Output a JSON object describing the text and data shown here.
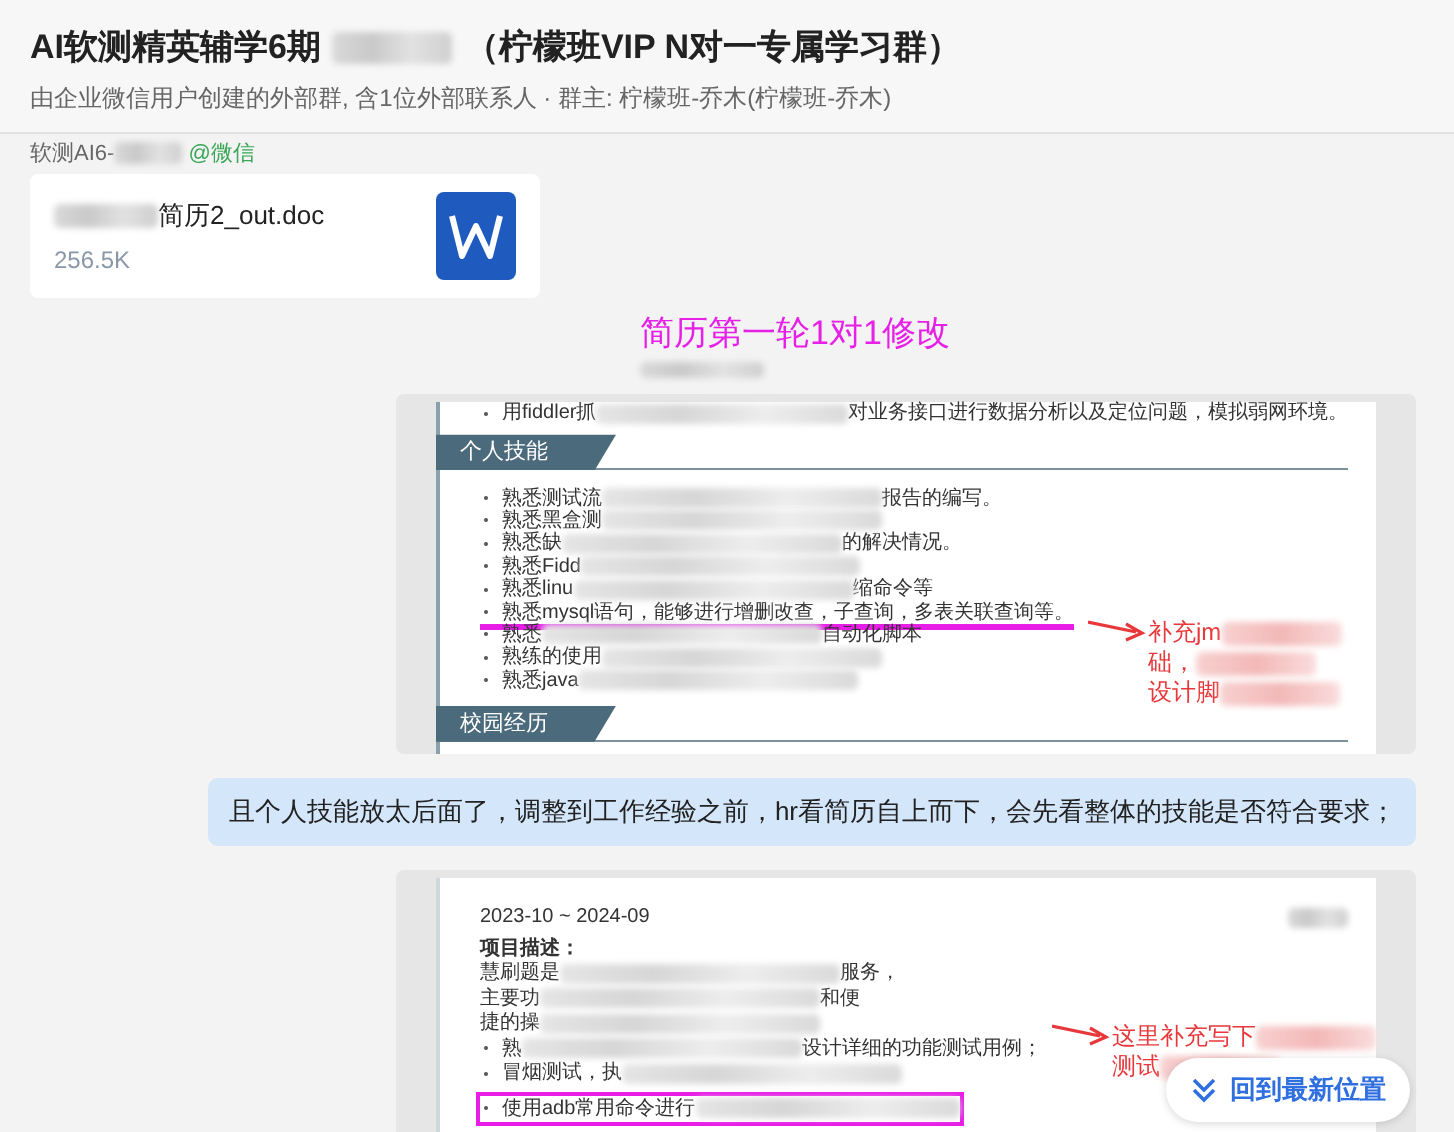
{
  "header": {
    "title_start": "AI软测精英辅学6期",
    "title_end": "（柠檬班VIP N对一专属学习群）",
    "subtitle": "由企业微信用户创建的外部群, 含1位外部联系人 · 群主: 柠檬班-乔木(柠檬班-乔木)"
  },
  "messages": [
    {
      "kind": "sender",
      "name": "软测AI6-",
      "tag": "@微信"
    },
    {
      "kind": "file",
      "name": "简历2_out.doc",
      "size": "256.5K"
    },
    {
      "kind": "note",
      "text": "简历第一轮1对1修改"
    },
    {
      "kind": "image",
      "rows": [
        {
          "kind": "line",
          "start": "用fiddler抓",
          "end": "对业务接口进行数据分析以及定位问题，模拟弱网环境。",
          "bullet": true,
          "redacted": true,
          "highlighted": false
        },
        {
          "kind": "heading",
          "text": "个人技能"
        },
        {
          "kind": "line",
          "start": "熟悉测试流",
          "end": "报告的编写。",
          "bullet": true,
          "redacted": true,
          "highlighted": false
        },
        {
          "kind": "line",
          "start": "熟悉黑盒测",
          "bullet": true,
          "redacted": true,
          "highlighted": false
        },
        {
          "kind": "line",
          "start": "熟悉缺",
          "end": "的解决情况。",
          "bullet": true,
          "redacted": true,
          "highlighted": false
        },
        {
          "kind": "line",
          "start": "熟悉Fidd",
          "bullet": true,
          "redacted": true,
          "highlighted": false
        },
        {
          "kind": "line",
          "start": "熟悉linu",
          "end": "缩命令等",
          "bullet": true,
          "redacted": true,
          "highlighted": false
        },
        {
          "kind": "line",
          "start": "熟悉mysql语句，能够进行增删改查，子查询，多表关联查询等。",
          "bullet": true,
          "redacted": false,
          "highlighted": true
        },
        {
          "kind": "line",
          "start": "熟悉",
          "end": "自动化脚本",
          "bullet": true,
          "redacted": true,
          "highlighted": false
        },
        {
          "kind": "line",
          "start": "熟练的使用",
          "bullet": true,
          "redacted": true,
          "highlighted": false
        },
        {
          "kind": "line",
          "start": "熟悉java",
          "bullet": true,
          "redacted": true,
          "highlighted": false
        },
        {
          "kind": "heading",
          "text": "校园经历"
        }
      ],
      "annotation": [
        "补充jm",
        "础，",
        "设计脚"
      ]
    },
    {
      "kind": "bubble",
      "text": "且个人技能放太后面了，调整到工作经验之前，hr看简历自上而下，会先看整体的技能是否符合要求；"
    },
    {
      "kind": "image",
      "rows": [
        {
          "kind": "date",
          "text": "2023-10 ~ 2024-09"
        },
        {
          "kind": "label",
          "text": "项目描述："
        },
        {
          "kind": "line",
          "start": "慧刷题是",
          "end": "服务，",
          "bullet": false,
          "redacted": true,
          "highlighted": false
        },
        {
          "kind": "line",
          "start": "主要功",
          "end": "和便",
          "bullet": false,
          "redacted": true,
          "highlighted": false
        },
        {
          "kind": "line",
          "start": "捷的操",
          "bullet": false,
          "redacted": true,
          "highlighted": false
        },
        {
          "kind": "line",
          "start": "熟",
          "end": "设计详细的功能测试用例；",
          "bullet": true,
          "redacted": true,
          "highlighted": false
        },
        {
          "kind": "line",
          "start": "冒烟测试，执",
          "bullet": true,
          "redacted": true,
          "highlighted": false
        },
        {
          "kind": "line",
          "start": "使用adb常用命令进行",
          "bullet": true,
          "redacted": true,
          "highlighted": true
        }
      ],
      "annotation": [
        "这里补充写下",
        "测试"
      ]
    }
  ],
  "jump_button": {
    "label": "回到最新位置"
  }
}
